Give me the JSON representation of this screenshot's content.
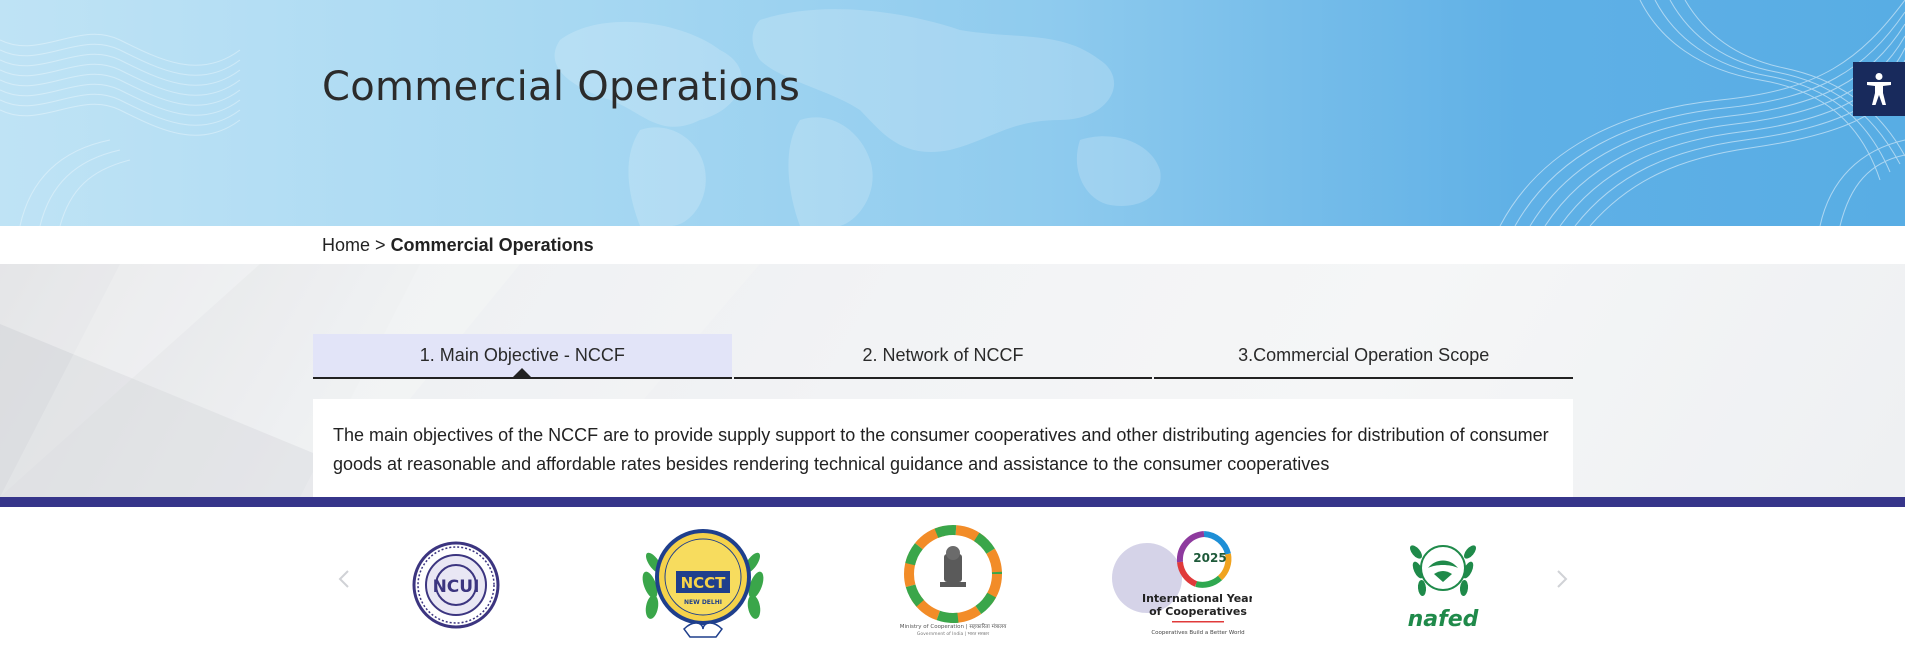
{
  "page": {
    "title": "Commercial Operations"
  },
  "breadcrumb": {
    "home": "Home",
    "separator": ">",
    "current": "Commercial Operations"
  },
  "tabs": [
    {
      "label": "1. Main Objective - NCCF",
      "active": true
    },
    {
      "label": "2. Network of NCCF",
      "active": false
    },
    {
      "label": "3.Commercial Operation Scope",
      "active": false
    }
  ],
  "panel": {
    "text": "The main objectives of the NCCF are to provide supply support to the consumer cooperatives and other distributing agencies for distribution of consumer goods at reasonable and affordable rates besides rendering technical guidance and assistance to the consumer cooperatives"
  },
  "logos": {
    "ncui": {
      "text": "NCUI"
    },
    "ncct": {
      "text": "NCCT",
      "subtext": "NEW DELHI"
    },
    "moc": {
      "line1": "Ministry of Cooperation | सहकारिता मंत्रालय",
      "line2": "Government of India | भारत सरकार"
    },
    "iyc": {
      "year": "2025",
      "line1": "International Year",
      "line2": "of Cooperatives",
      "tagline": "Cooperatives Build a Better World"
    },
    "nafed": {
      "text": "nafed"
    }
  },
  "icons": {
    "accessibility": "accessibility-icon",
    "prev": "chevron-left-icon",
    "next": "chevron-right-icon"
  },
  "colors": {
    "footer_strip": "#36358a",
    "active_tab": "#e2e4f8",
    "accessibility_button": "#182a5c"
  }
}
